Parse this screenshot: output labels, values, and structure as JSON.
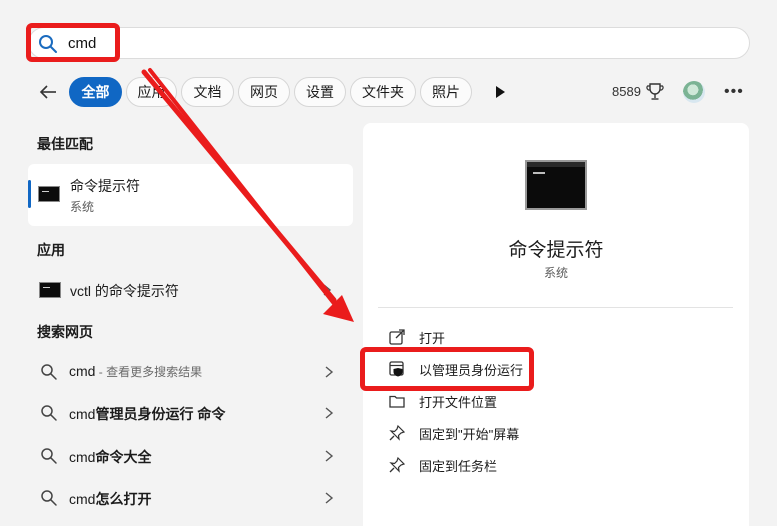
{
  "search": {
    "query": "cmd"
  },
  "filters": {
    "chips": [
      "全部",
      "应用",
      "文档",
      "网页",
      "设置",
      "文件夹",
      "照片"
    ],
    "points": "8589"
  },
  "best_match": {
    "heading": "最佳匹配",
    "name": "命令提示符",
    "type": "系统"
  },
  "apps": {
    "heading": "应用",
    "items": [
      {
        "name": "vctl 的命令提示符"
      }
    ]
  },
  "web": {
    "heading": "搜索网页",
    "items": [
      {
        "query": "cmd",
        "hint": " - 查看更多搜索结果"
      },
      {
        "query": "cmd",
        "bold": "管理员身份运行 命令"
      },
      {
        "query": "cmd",
        "bold": "命令大全"
      },
      {
        "query": "cmd",
        "bold": "怎么打开"
      }
    ]
  },
  "detail": {
    "title": "命令提示符",
    "subtitle": "系统",
    "actions": [
      "打开",
      "以管理员身份运行",
      "打开文件位置",
      "固定到\"开始\"屏幕",
      "固定到任务栏"
    ]
  },
  "colors": {
    "accent": "#1067c4",
    "annotation": "#ea1c1c"
  }
}
